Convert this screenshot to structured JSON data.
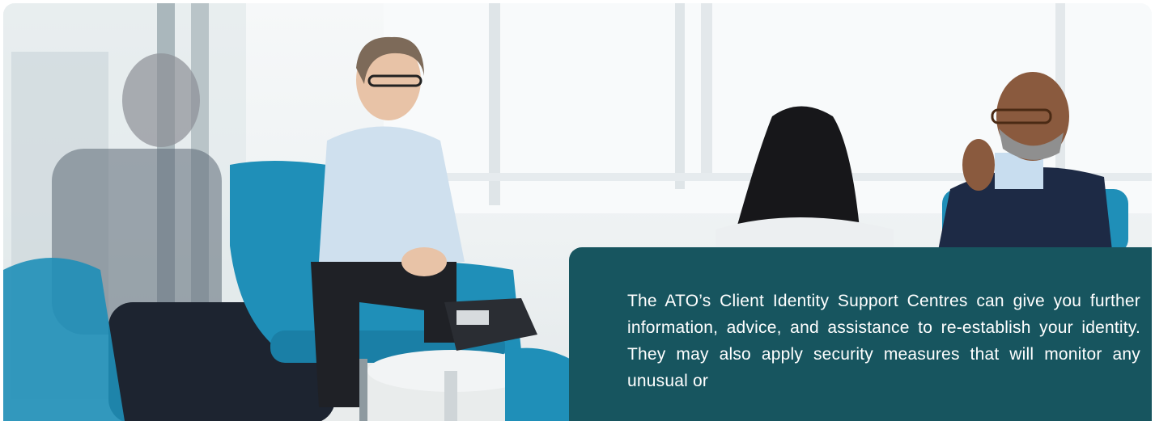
{
  "hero": {
    "image": "office-meeting-photo",
    "palette": {
      "chair": "#1f8fb8",
      "suit": "#1d2a45",
      "panel": "#17555f",
      "window": "#f5f8f9"
    }
  },
  "info_panel": {
    "text": "The ATO’s Client Identity Support Centres can give you further information, advice, and assistance to re-establish your identity. They may also apply security measures that will monitor any unusual or"
  }
}
